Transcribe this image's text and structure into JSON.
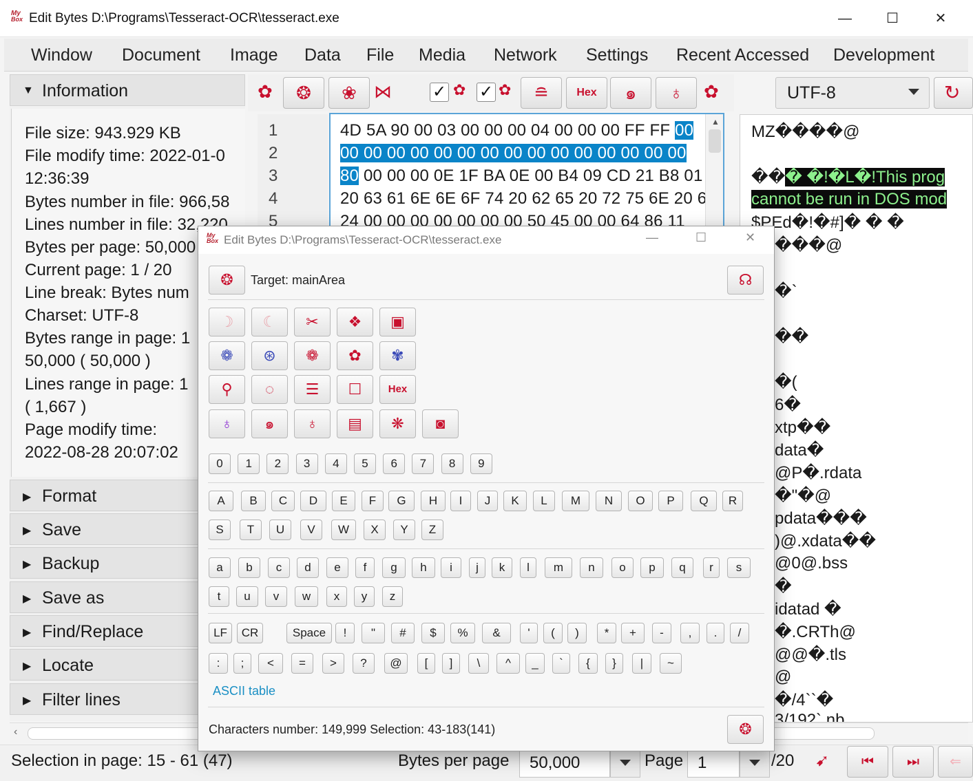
{
  "window": {
    "title": "Edit Bytes  D:\\Programs\\Tesseract-OCR\\tesseract.exe",
    "logo_top": "My",
    "logo_bottom": "Box",
    "min": "—",
    "max": "☐",
    "close": "✕"
  },
  "menu": [
    "Window",
    "Document",
    "Image",
    "Data",
    "File",
    "Media",
    "Network",
    "Settings",
    "Recent Accessed",
    "Development"
  ],
  "sidebar": {
    "info_title": "Information",
    "info_lines": [
      "File size: 943.929 KB",
      "File modify time: 2022-01-0",
      "12:36:39",
      "Bytes number in file: 966,58",
      "Lines number in file: 32,220",
      "Bytes per page: 50,000",
      "Current page: 1 / 20",
      "Line break: Bytes num",
      "Charset: UTF-8",
      "Bytes range in page: 1",
      "50,000 ( 50,000 )",
      "Lines range in page: 1",
      "( 1,667 )",
      "Page modify time:",
      "2022-08-28 20:07:02"
    ],
    "sections": [
      "Format",
      "Save",
      "Backup",
      "Save as",
      "Find/Replace",
      "Locate",
      "Filter lines"
    ]
  },
  "toolbar": {
    "hex_label": "Hex",
    "check1": "✓",
    "check2": "✓"
  },
  "editor": {
    "line_numbers": [
      "1",
      "2",
      "3",
      "4",
      "5"
    ],
    "line1_plain": "4D 5A 90 00 03 00 00 00 04 00 00 00 FF FF ",
    "line1_sel": "00",
    "line2_sel": "00 00 00 00 00 00 00 00 00 00 00 00 00 00 00",
    "line3_sel": "80",
    "line3_plain": " 00 00 00 0E 1F BA 0E 00 B4 09 CD 21 B8 01",
    "line4": "20 63 61 6E 6E 6F 74 20 62 65 20 72 75 6E 20 6",
    "line5": "24 00 00 00 00 00 00 00 50 45 00 00 64 86 11"
  },
  "right": {
    "charset": "UTF-8",
    "text_lines": [
      {
        "text": "MZ����@",
        "hl": false
      },
      {
        "text": "",
        "hl": false
      },
      {
        "text_plain": "��",
        "text_hl": "�     �!�L�!This prog",
        "mixed": true
      },
      {
        "text": " cannot be run in DOS mod",
        "hl": true
      },
      {
        "text": "$PEd�!�#]� � �",
        "hl": false
      },
      {
        "text": "���@",
        "hl": false
      }
    ],
    "partial_lines": [
      "�`",
      "",
      "��",
      "",
      "�(",
      "6�",
      "xtp��",
      "data�",
      "@P�.rdata",
      "�\"�@",
      "pdata���",
      ")@.xdata��",
      "@0@.bss",
      "�",
      "idatad �",
      "�.CRTh@",
      "@@�.tls",
      "@",
      "�/4``�",
      "3/192`.nb"
    ]
  },
  "status": {
    "selection": "Selection in page: 15 - 61 (47)",
    "bytes_per_page_label": "Bytes per page",
    "bytes_per_page_value": "50,000",
    "page_label": "Page",
    "page_value": "1",
    "page_total": "/20"
  },
  "dialog": {
    "title": "Edit Bytes  D:\\Programs\\Tesseract-OCR\\tesseract.exe",
    "target": "Target: mainArea",
    "hex_label": "Hex",
    "digits": [
      "0",
      "1",
      "2",
      "3",
      "4",
      "5",
      "6",
      "7",
      "8",
      "9"
    ],
    "upper_row1": [
      "A",
      "B",
      "C",
      "D",
      "E",
      "F",
      "G",
      "H",
      "I",
      "J",
      "K",
      "L",
      "M",
      "N",
      "O",
      "P",
      "Q",
      "R"
    ],
    "upper_row2": [
      "S",
      "T",
      "U",
      "V",
      "W",
      "X",
      "Y",
      "Z"
    ],
    "lower_row1": [
      "a",
      "b",
      "c",
      "d",
      "e",
      "f",
      "g",
      "h",
      "i",
      "j",
      "k",
      "l",
      "m",
      "n",
      "o",
      "p",
      "q",
      "r",
      "s"
    ],
    "lower_row2": [
      "t",
      "u",
      "v",
      "w",
      "x",
      "y",
      "z"
    ],
    "sym_row1": [
      "LF",
      "CR",
      "Space",
      "!",
      "\"",
      "#",
      "$",
      "%",
      "&",
      "'",
      "(",
      ")",
      "*",
      "+",
      "-",
      ",",
      ".",
      "/"
    ],
    "sym_row2": [
      ":",
      ";",
      "<",
      "=",
      ">",
      "?",
      "@",
      "[",
      "]",
      "\\",
      "^",
      "_",
      "`",
      "{",
      "}",
      "|",
      "~"
    ],
    "ascii_link": "ASCII table",
    "footer": "Characters number: 149,999  Selection: 43-183(141)"
  },
  "colors": {
    "accent_red": "#c8102e",
    "selection_blue": "#0a84c8",
    "highlight_bg": "#0b0b0b",
    "highlight_fg": "#8df08d",
    "link": "#1a8fc4"
  }
}
